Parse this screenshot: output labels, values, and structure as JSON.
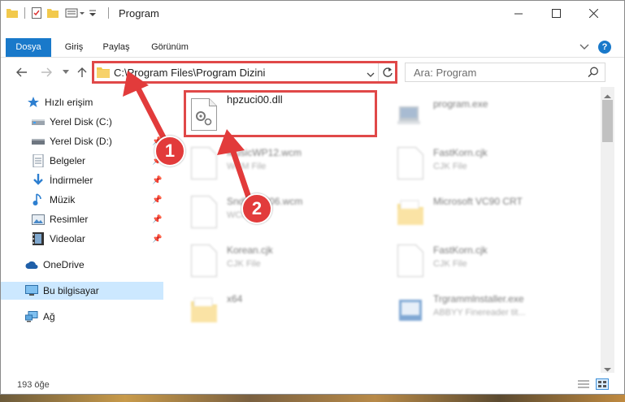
{
  "window": {
    "title": "Program"
  },
  "ribbon": {
    "tabs": [
      "Dosya",
      "Giriş",
      "Paylaş",
      "Görünüm"
    ]
  },
  "address": {
    "path": "C:\\Program Files\\Program Dizini"
  },
  "search": {
    "placeholder": "Ara: Program"
  },
  "sidebar": {
    "quick_access": "Hızlı erişim",
    "items": [
      {
        "label": "Yerel Disk (C:)",
        "icon": "drive-icon"
      },
      {
        "label": "Yerel Disk (D:)",
        "icon": "drive-icon"
      },
      {
        "label": "Belgeler",
        "icon": "documents-icon"
      },
      {
        "label": "İndirmeler",
        "icon": "download-icon"
      },
      {
        "label": "Müzik",
        "icon": "music-icon"
      },
      {
        "label": "Resimler",
        "icon": "pictures-icon"
      },
      {
        "label": "Videolar",
        "icon": "video-icon"
      }
    ],
    "onedrive": "OneDrive",
    "this_pc": "Bu bilgisayar",
    "network": "Ağ"
  },
  "files": [
    {
      "name": "hpzuci00.dll",
      "type": ""
    },
    {
      "name": "program.exe",
      "type": ""
    },
    {
      "name": "MusicWP12.wcm",
      "type": "WCM File"
    },
    {
      "name": "FastKorn.cjk",
      "type": "CJK File"
    },
    {
      "name": "SndFnt2006.wcm",
      "type": "WCM File"
    },
    {
      "name": "Microsoft VC90 CRT",
      "type": ""
    },
    {
      "name": "Korean.cjk",
      "type": "CJK File"
    },
    {
      "name": "FastKorn.cjk",
      "type": "CJK File"
    },
    {
      "name": "x64",
      "type": ""
    },
    {
      "name": "Trgrammlnstaller.exe",
      "type": "ABBYY Finereader tit..."
    }
  ],
  "status": {
    "item_count": "193 öğe"
  },
  "callouts": [
    "1",
    "2"
  ],
  "colors": {
    "accent": "#1979ca",
    "callout": "#e23b3b",
    "selection": "#cce8ff"
  }
}
